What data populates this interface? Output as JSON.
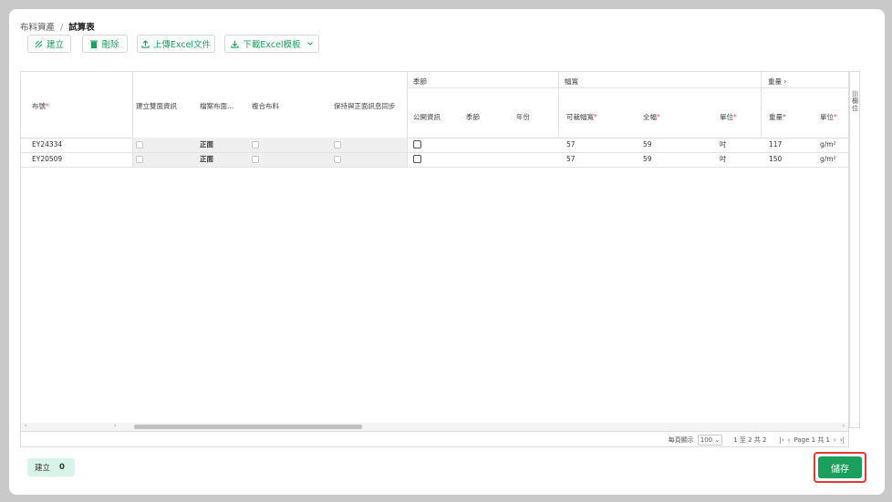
{
  "breadcrumb": {
    "parent": "布料資產",
    "separator": "/",
    "current": "試算表"
  },
  "toolbar": {
    "create_label": "建立",
    "delete_label": "刪除",
    "upload_label": "上傳Excel文件",
    "download_label": "下載Excel模板"
  },
  "grid": {
    "groups": {
      "season": "季節",
      "width": "幅寬",
      "weight": "重量"
    },
    "columns": {
      "fabric_no": "布號",
      "create_double": "建立雙面資訊",
      "face_side": "檔案布面...",
      "composite": "複合布料",
      "sync": "保持與正面訊息同步",
      "public_info": "公開資訊",
      "season": "季節",
      "year": "年份",
      "usable_width": "可裁幅寬",
      "full_width": "全幅",
      "width_unit": "單位",
      "weight": "重量",
      "weight_unit": "單位"
    },
    "rows": [
      {
        "fabric_no": "EY24334",
        "face": "正面",
        "usable_width": "57",
        "full_width": "59",
        "unit": "吋",
        "weight": "117",
        "weight_unit": "g/m²"
      },
      {
        "fabric_no": "EY20509",
        "face": "正面",
        "usable_width": "57",
        "full_width": "59",
        "unit": "吋",
        "weight": "150",
        "weight_unit": "g/m²"
      }
    ],
    "side_panel": "欄位"
  },
  "pager": {
    "per_page_label": "每頁顯示",
    "per_page": "100",
    "range": "1 至 2 共 2",
    "page": "Page 1 共 1"
  },
  "footer": {
    "create_count_label": "建立",
    "create_count": "0",
    "save_label": "儲存"
  },
  "colors": {
    "accent": "#1c9e5c",
    "highlight": "#e53935"
  }
}
